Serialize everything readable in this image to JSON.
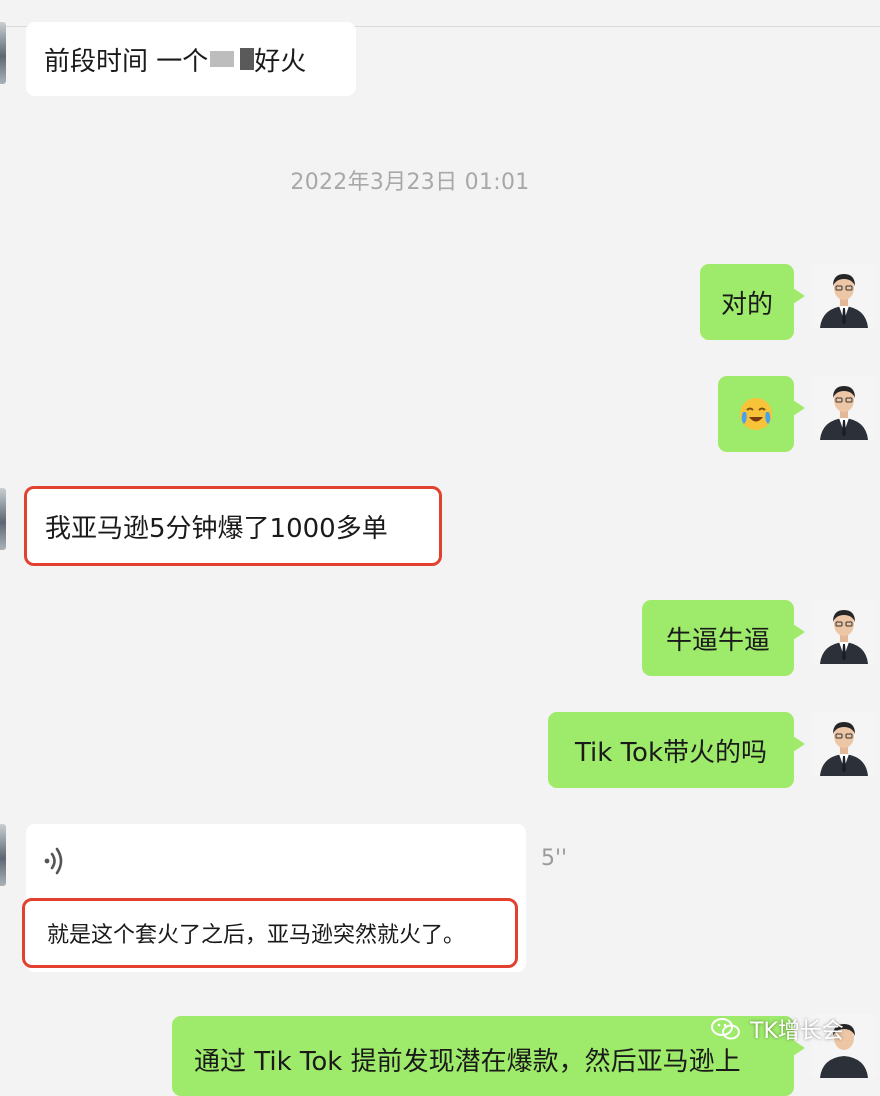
{
  "timestamp": "2022年3月23日 01:01",
  "messages": {
    "m1": {
      "pre": "前段时间 一个",
      "post": "好火"
    },
    "m2": "对的",
    "m3": "😭",
    "m4": "我亚马逊5分钟爆了1000多单",
    "m5": "牛逼牛逼",
    "m6": "Tik Tok带火的吗",
    "m7": {
      "duration": "5''",
      "transcript": "就是这个套火了之后，亚马逊突然就火了。"
    },
    "m8": "通过 Tik Tok 提前发现潜在爆款，然后亚马逊上"
  },
  "watermark": "TK增长会",
  "colors": {
    "sent_bubble": "#9eea6a",
    "received_bubble": "#ffffff",
    "highlight": "#e3412f",
    "background": "#f3f3f3"
  }
}
